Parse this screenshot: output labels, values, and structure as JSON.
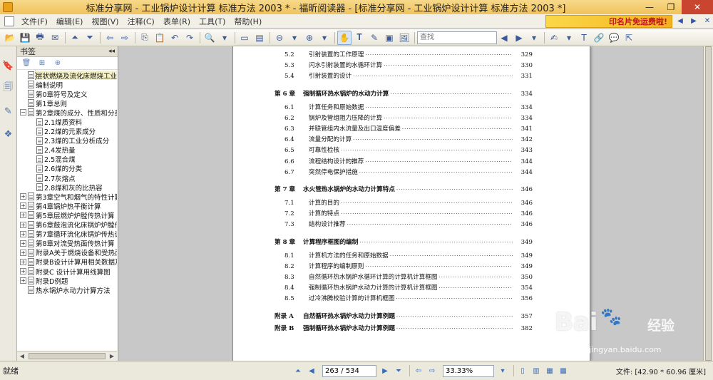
{
  "window": {
    "title": "标准分享网 - 工业锅炉设计计算 标准方法 2003 * - 福昕阅读器 - [标准分享网 - 工业锅炉设计计算 标准方法 2003 *]",
    "minimize": "—",
    "maximize": "❐",
    "close": "✕"
  },
  "menu": {
    "items": [
      "文件(F)",
      "编辑(E)",
      "视图(V)",
      "注释(C)",
      "表单(R)",
      "工具(T)",
      "帮助(H)"
    ],
    "ad_text": "印名片免运费啦!"
  },
  "toolbar": {
    "search_placeholder": "查找"
  },
  "bookmarks": {
    "title": "书签",
    "collapse": "◂◂",
    "items": [
      {
        "label": "层状燃烧及流化床燃烧工业锅炉",
        "toggle": "",
        "indent": 0,
        "selected": true
      },
      {
        "label": "编制说明",
        "toggle": "",
        "indent": 0
      },
      {
        "label": "第0章符号及定义",
        "toggle": "",
        "indent": 0
      },
      {
        "label": "第1章总则",
        "toggle": "",
        "indent": 0
      },
      {
        "label": "第2章煤的成分、性质和分类",
        "toggle": "−",
        "indent": 0
      },
      {
        "label": "2.1煤质资料",
        "toggle": "",
        "indent": 1
      },
      {
        "label": "2.2煤的元素成分",
        "toggle": "",
        "indent": 1
      },
      {
        "label": "2.3煤的工业分析成分",
        "toggle": "",
        "indent": 1
      },
      {
        "label": "2.4发热量",
        "toggle": "",
        "indent": 1
      },
      {
        "label": "2.5混合煤",
        "toggle": "",
        "indent": 1
      },
      {
        "label": "2.6煤的分类",
        "toggle": "",
        "indent": 1
      },
      {
        "label": "2.7灰熔点",
        "toggle": "",
        "indent": 1
      },
      {
        "label": "2.8煤和灰的比热容",
        "toggle": "",
        "indent": 1
      },
      {
        "label": "第3章空气和烟气的特性计算",
        "toggle": "+",
        "indent": 0
      },
      {
        "label": "第4章锅炉热平衡计算",
        "toggle": "+",
        "indent": 0
      },
      {
        "label": "第5章层燃炉炉膛传热计算",
        "toggle": "+",
        "indent": 0
      },
      {
        "label": "第6章鼓泡流化床锅炉炉膛传热计算",
        "toggle": "+",
        "indent": 0
      },
      {
        "label": "第7章循环流化床锅炉传热计算",
        "toggle": "+",
        "indent": 0
      },
      {
        "label": "第8章对流受热面传热计算",
        "toggle": "+",
        "indent": 0
      },
      {
        "label": "附录A关于燃烧设备和受热面",
        "toggle": "+",
        "indent": 0
      },
      {
        "label": "附录B设计计算用相关数据及",
        "toggle": "+",
        "indent": 0
      },
      {
        "label": "附录C 设计计算用线算图",
        "toggle": "+",
        "indent": 0
      },
      {
        "label": "附录D例题",
        "toggle": "+",
        "indent": 0
      },
      {
        "label": "热水锅炉水动力计算方法",
        "toggle": "",
        "indent": 0
      }
    ]
  },
  "toc": [
    {
      "kind": "item",
      "num": "5.2",
      "title": "引射装置的工作原理",
      "page": "329"
    },
    {
      "kind": "item",
      "num": "5.3",
      "title": "闪水引射装置的水循环计算",
      "page": "330"
    },
    {
      "kind": "item",
      "num": "5.4",
      "title": "引射装置的设计",
      "page": "331"
    },
    {
      "kind": "chapter",
      "num": "第 6 章",
      "title": "强制循环热水锅炉的水动力计算",
      "page": "334"
    },
    {
      "kind": "item",
      "num": "6.1",
      "title": "计算任务和原始数据",
      "page": "334"
    },
    {
      "kind": "item",
      "num": "6.2",
      "title": "锅炉及管组阻力压降的计算",
      "page": "334"
    },
    {
      "kind": "item",
      "num": "6.3",
      "title": "并联管组内水流量及出口温度偏差",
      "page": "341"
    },
    {
      "kind": "item",
      "num": "6.4",
      "title": "流量分配的计算",
      "page": "342"
    },
    {
      "kind": "item",
      "num": "6.5",
      "title": "可靠性检核",
      "page": "343"
    },
    {
      "kind": "item",
      "num": "6.6",
      "title": "流程结构设计的推荐",
      "page": "344"
    },
    {
      "kind": "item",
      "num": "6.7",
      "title": "突然停电保护措施",
      "page": "344"
    },
    {
      "kind": "chapter",
      "num": "第 7 章",
      "title": "水火管热水锅炉的水动力计算特点",
      "page": "346"
    },
    {
      "kind": "item",
      "num": "7.1",
      "title": "计算的目的",
      "page": "346"
    },
    {
      "kind": "item",
      "num": "7.2",
      "title": "计算的特点",
      "page": "346"
    },
    {
      "kind": "item",
      "num": "7.3",
      "title": "结构设计推荐",
      "page": "346"
    },
    {
      "kind": "chapter",
      "num": "第 8 章",
      "title": "计算程序框图的编制",
      "page": "349"
    },
    {
      "kind": "item",
      "num": "8.1",
      "title": "计算机方法的任务和原始数据",
      "page": "349"
    },
    {
      "kind": "item",
      "num": "8.2",
      "title": "计算程序的编制原则",
      "page": "349"
    },
    {
      "kind": "item",
      "num": "8.3",
      "title": "自然循环热水锅炉水循环计算的计算机计算框图",
      "page": "350"
    },
    {
      "kind": "item",
      "num": "8.4",
      "title": "强制循环热水锅炉水动力计算的计算机计算框图",
      "page": "354"
    },
    {
      "kind": "item",
      "num": "8.5",
      "title": "过冷沸腾校验计算的计算机框图",
      "page": "356"
    },
    {
      "kind": "appendix",
      "num": "附录 A",
      "title": "自然循环热水锅炉水动力计算例题",
      "page": "357"
    },
    {
      "kind": "appendix",
      "num": "附录 B",
      "title": "强制循环热水锅炉水动力计算例题",
      "page": "382"
    }
  ],
  "status": {
    "text": "就绪",
    "page_indicator": "263 / 534",
    "zoom": "33.33%",
    "file_size": "文件: [42.90 * 60.96 厘米]"
  },
  "watermark": {
    "logo": "Bai",
    "brand_cn": "经验",
    "url": "jingyan.baidu.com"
  }
}
